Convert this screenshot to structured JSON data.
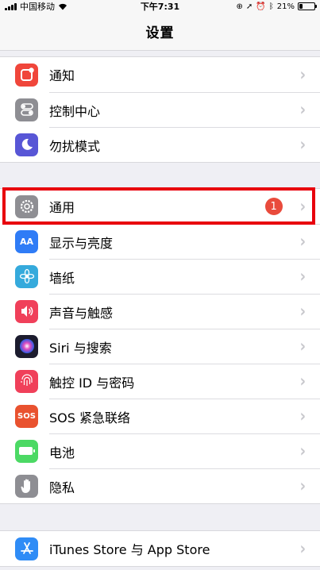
{
  "status_bar": {
    "carrier": "中国移动",
    "time": "下午7:31",
    "battery_percent": "21%",
    "battery_level": 0.21
  },
  "nav": {
    "title": "设置"
  },
  "groups": [
    {
      "items": [
        {
          "label": "通知",
          "icon": "notifications-icon",
          "color": "#f0463b"
        },
        {
          "label": "控制中心",
          "icon": "control-center-icon",
          "color": "#8e8e93"
        },
        {
          "label": "勿扰模式",
          "icon": "moon-icon",
          "color": "#5856d6"
        }
      ]
    },
    {
      "items": [
        {
          "label": "通用",
          "icon": "gear-icon",
          "color": "#8e8e93",
          "badge": "1"
        },
        {
          "label": "显示与亮度",
          "icon": "display-icon",
          "color": "#2f7cf6",
          "icon_text": "AA"
        },
        {
          "label": "墙纸",
          "icon": "wallpaper-flower-icon",
          "color": "#35aadc"
        },
        {
          "label": "声音与触感",
          "icon": "speaker-icon",
          "color": "#f0405a"
        },
        {
          "label": "Siri 与搜索",
          "icon": "siri-icon",
          "color": "#1c1c2e"
        },
        {
          "label": "触控 ID 与密码",
          "icon": "fingerprint-icon",
          "color": "#f0405a"
        },
        {
          "label": "SOS 紧急联络",
          "icon": "sos-icon",
          "color": "#e9522f",
          "icon_text": "SOS"
        },
        {
          "label": "电池",
          "icon": "battery-icon",
          "color": "#4cd964"
        },
        {
          "label": "隐私",
          "icon": "hand-icon",
          "color": "#8e8e93"
        }
      ]
    },
    {
      "items": [
        {
          "label": "iTunes Store 与 App Store",
          "icon": "app-store-icon",
          "color": "#2f8cf6"
        }
      ]
    }
  ]
}
